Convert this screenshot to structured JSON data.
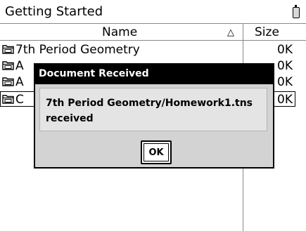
{
  "window": {
    "title": "Getting Started"
  },
  "columns": {
    "name": "Name",
    "sort_indicator": "△",
    "size": "Size"
  },
  "rows": [
    {
      "name": "7th Period Geometry",
      "size": "0K",
      "selected": false
    },
    {
      "name": "A",
      "size": "0K",
      "selected": false
    },
    {
      "name": "A",
      "size": "0K",
      "selected": false
    },
    {
      "name": "C",
      "size": "0K",
      "selected": true
    }
  ],
  "dialog": {
    "title": "Document Received",
    "message_line1": "7th Period Geometry/Homework1.tns",
    "message_line2": "received",
    "ok_label": "OK"
  },
  "colors": {
    "dialog_header": "#000000",
    "dialog_background": "#d3d3d3"
  }
}
